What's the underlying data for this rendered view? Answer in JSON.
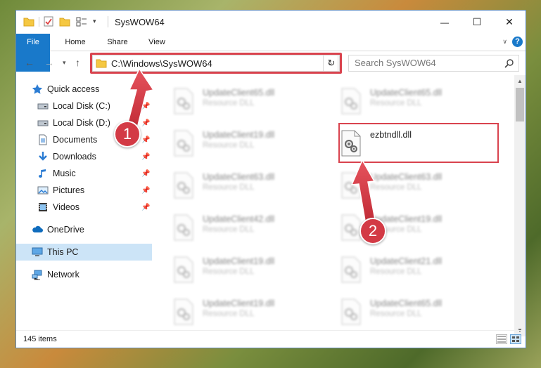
{
  "window": {
    "title": "SysWOW64",
    "controls": {
      "minimize": "—",
      "maximize": "☐",
      "close": "✕"
    }
  },
  "ribbon": {
    "tabs": [
      {
        "label": "File"
      },
      {
        "label": "Home"
      },
      {
        "label": "Share"
      },
      {
        "label": "View"
      }
    ],
    "help": "?"
  },
  "address": {
    "path": "C:\\Windows\\SysWOW64",
    "search_placeholder": "Search SysWOW64"
  },
  "sidebar": {
    "items": [
      {
        "label": "Quick access",
        "icon": "star-icon",
        "pinned": false
      },
      {
        "label": "Local Disk (C:)",
        "icon": "drive-icon",
        "pinned": true
      },
      {
        "label": "Local Disk (D:)",
        "icon": "drive-icon",
        "pinned": true
      },
      {
        "label": "Documents",
        "icon": "documents-icon",
        "pinned": true
      },
      {
        "label": "Downloads",
        "icon": "download-icon",
        "pinned": true
      },
      {
        "label": "Music",
        "icon": "music-icon",
        "pinned": true
      },
      {
        "label": "Pictures",
        "icon": "pictures-icon",
        "pinned": true
      },
      {
        "label": "Videos",
        "icon": "videos-icon",
        "pinned": true
      },
      {
        "label": "OneDrive",
        "icon": "cloud-icon",
        "pinned": false
      },
      {
        "label": "This PC",
        "icon": "computer-icon",
        "pinned": false,
        "selected": true
      },
      {
        "label": "Network",
        "icon": "network-icon",
        "pinned": false
      }
    ]
  },
  "files": [
    {
      "name": "UpdateClient65.dll",
      "type": "Resource DLL"
    },
    {
      "name": "UpdateClient65.dll",
      "type": "Resource DLL"
    },
    {
      "name": "UpdateClient19.dll",
      "type": "Resource DLL"
    },
    {
      "name": "ezbtndll.dll",
      "type": ""
    },
    {
      "name": "UpdateClient63.dll",
      "type": "Resource DLL"
    },
    {
      "name": "UpdateClient63.dll",
      "type": "Resource DLL"
    },
    {
      "name": "UpdateClient42.dll",
      "type": "Resource DLL"
    },
    {
      "name": "UpdateClient19.dll",
      "type": "Resource DLL"
    },
    {
      "name": "UpdateClient19.dll",
      "type": "Resource DLL"
    },
    {
      "name": "UpdateClient21.dll",
      "type": "Resource DLL"
    },
    {
      "name": "UpdateClient19.dll",
      "type": "Resource DLL"
    },
    {
      "name": "UpdateClient65.dll",
      "type": "Resource DLL"
    }
  ],
  "status": {
    "item_count": "145 items"
  },
  "callouts": [
    {
      "label": "1"
    },
    {
      "label": "2"
    }
  ],
  "colors": {
    "accent": "#1979ca",
    "highlight": "#d9434e",
    "selected": "#cce4f7"
  }
}
